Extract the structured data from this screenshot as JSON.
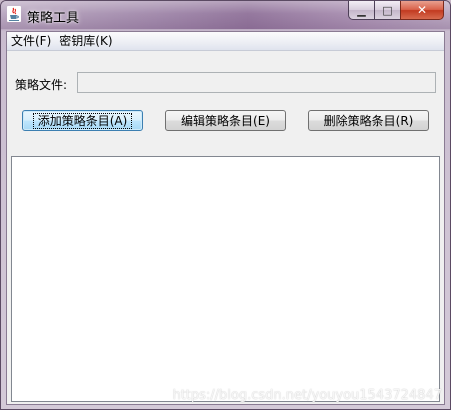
{
  "window": {
    "title": "策略工具",
    "app_icon": "java-coffee-icon",
    "caption": {
      "minimize_glyph": "▁",
      "maximize_glyph": "□",
      "close_glyph": "✕"
    }
  },
  "menubar": {
    "items": [
      {
        "label": "文件(F)"
      },
      {
        "label": "密钥库(K)"
      }
    ]
  },
  "policy_file": {
    "label": "策略文件:",
    "value": ""
  },
  "buttons": {
    "add": "添加策略条目(A)",
    "edit": "编辑策略条目(E)",
    "delete": "删除策略条目(R)"
  },
  "entries": [],
  "watermark": "https://blog.csdn.net/youyou1543724847",
  "colors": {
    "accent_focus": "#3c7fb1",
    "close_button": "#c23a20",
    "client_bg": "#f0f0f0"
  }
}
